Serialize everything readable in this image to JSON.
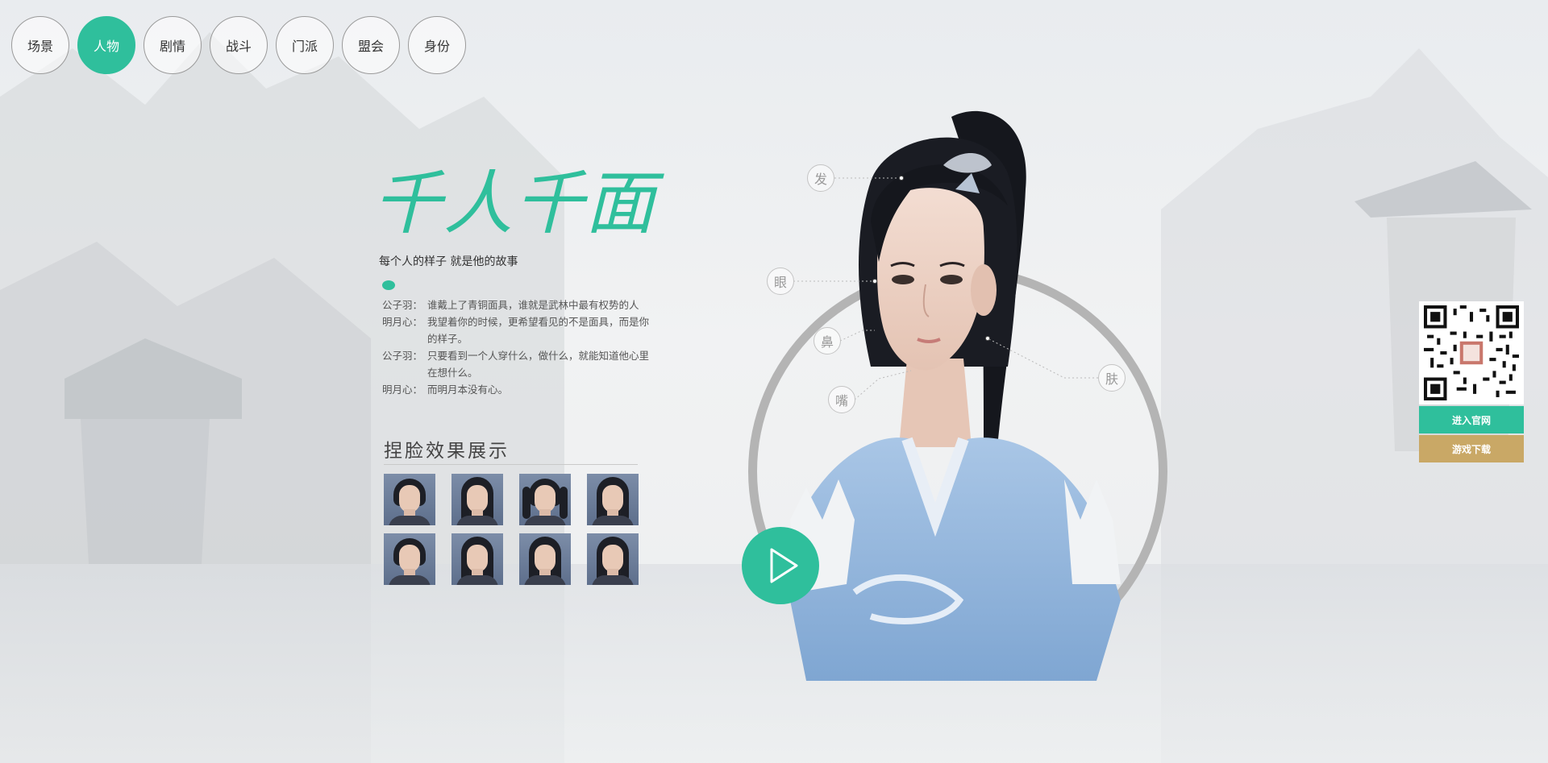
{
  "nav": {
    "items": [
      {
        "label": "场景",
        "active": false
      },
      {
        "label": "人物",
        "active": true
      },
      {
        "label": "剧情",
        "active": false
      },
      {
        "label": "战斗",
        "active": false
      },
      {
        "label": "门派",
        "active": false
      },
      {
        "label": "盟会",
        "active": false
      },
      {
        "label": "身份",
        "active": false
      }
    ]
  },
  "hero": {
    "title": "千人千面",
    "subtitle": "每个人的样子 就是他的故事"
  },
  "dialog": [
    {
      "speaker": "公子羽：",
      "text": "谁戴上了青铜面具，谁就是武林中最有权势的人"
    },
    {
      "speaker": "明月心：",
      "text": "我望着你的时候，更希望看见的不是面具，而是你的样子。"
    },
    {
      "speaker": "公子羽：",
      "text": "只要看到一个人穿什么，做什么，就能知道他心里在想什么。"
    },
    {
      "speaker": "明月心：",
      "text": "而明月本没有心。"
    }
  ],
  "gallery": {
    "title": "捏脸效果展示"
  },
  "features": {
    "hair": "发",
    "eye": "眼",
    "nose": "鼻",
    "mouth": "嘴",
    "skin": "肤"
  },
  "side": {
    "official_site": "进入官网",
    "download": "游戏下载"
  },
  "colors": {
    "accent": "#2fbf9c",
    "gold": "#c9a866"
  },
  "icons": {
    "play": "play-icon",
    "qr": "qr-code"
  }
}
